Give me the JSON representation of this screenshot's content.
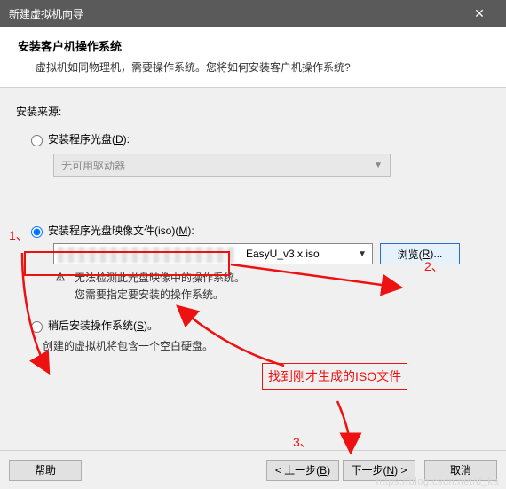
{
  "window": {
    "title": "新建虚拟机向导",
    "close_glyph": "✕"
  },
  "header": {
    "heading": "安装客户机操作系统",
    "subheading": "虚拟机如同物理机，需要操作系统。您将如何安装客户机操作系统?"
  },
  "source": {
    "label": "安装来源:",
    "opt_disc": {
      "label_pre": "安装程序光盘(",
      "hotkey": "D",
      "label_post": "):"
    },
    "disc_dropdown": "无可用驱动器",
    "opt_iso": {
      "label_pre": "安装程序光盘映像文件(iso)(",
      "hotkey": "M",
      "label_post": "):"
    },
    "iso_path_visible": "EasyU_v3.x.iso",
    "browse": {
      "label_pre": "浏览(",
      "hotkey": "R",
      "label_post": ")..."
    },
    "warn_glyph": "⚠",
    "warn_line1": "无法检测此光盘映像中的操作系统。",
    "warn_line2": "您需要指定要安装的操作系统。",
    "opt_later": {
      "label_pre": "稍后安装操作系统(",
      "hotkey": "S",
      "label_post": ")。"
    },
    "later_note": "创建的虚拟机将包含一个空白硬盘。"
  },
  "buttons": {
    "help": "帮助",
    "back": {
      "pre": "< 上一步(",
      "hotkey": "B",
      "post": ")"
    },
    "next": {
      "pre": "下一步(",
      "hotkey": "N",
      "post": ") >"
    },
    "cancel": "取消"
  },
  "annotations": {
    "n1": "1、",
    "n2": "2、",
    "n3": "3、",
    "tip": "找到刚才生成的ISO文件"
  },
  "watermark": "https://blog.csdn.net/d_ka"
}
